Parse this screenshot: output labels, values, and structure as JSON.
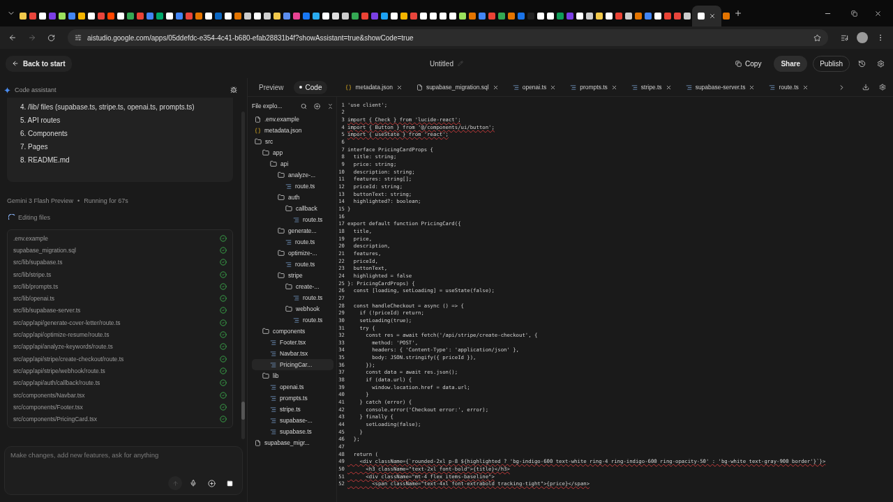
{
  "browser": {
    "tabs": [
      {
        "color": "#f2c94c",
        "selected": false
      },
      {
        "color": "#e8453c",
        "selected": false
      },
      {
        "color": "#ffffff",
        "selected": false
      },
      {
        "color": "#7b3fe4",
        "selected": false
      },
      {
        "color": "#9be15d",
        "selected": false
      },
      {
        "color": "#4285f4",
        "selected": false
      },
      {
        "color": "#f4b400",
        "selected": false
      },
      {
        "color": "#ffffff",
        "selected": false
      },
      {
        "color": "#e8453c",
        "selected": false
      },
      {
        "color": "#ff4500",
        "selected": false
      },
      {
        "color": "#ffffff",
        "selected": false
      },
      {
        "color": "#34a853",
        "selected": false
      },
      {
        "color": "#ea4335",
        "selected": false
      },
      {
        "color": "#4285f4",
        "selected": false
      },
      {
        "color": "#00a86b",
        "selected": false
      },
      {
        "color": "#ffffff",
        "selected": false
      },
      {
        "color": "#4285f4",
        "selected": false
      },
      {
        "color": "#e8453c",
        "selected": false
      },
      {
        "color": "#e37400",
        "selected": false
      },
      {
        "color": "#ffffff",
        "selected": false
      },
      {
        "color": "#0a66c2",
        "selected": false
      },
      {
        "color": "#ffffff",
        "selected": false
      },
      {
        "color": "#e37400",
        "selected": false
      },
      {
        "color": "#cccccc",
        "selected": false
      },
      {
        "color": "#ffffff",
        "selected": false
      },
      {
        "color": "#d0d0d0",
        "selected": false
      },
      {
        "color": "#f2c94c",
        "selected": false
      },
      {
        "color": "#5b8def",
        "selected": false
      },
      {
        "color": "#e84393",
        "selected": false
      },
      {
        "color": "#1877f2",
        "selected": false
      },
      {
        "color": "#2aabee",
        "selected": false
      },
      {
        "color": "#ffffff",
        "selected": false
      },
      {
        "color": "#dddddd",
        "selected": false
      },
      {
        "color": "#cccccc",
        "selected": false
      },
      {
        "color": "#34a853",
        "selected": false
      },
      {
        "color": "#ea4335",
        "selected": false
      },
      {
        "color": "#7b3fe4",
        "selected": false
      },
      {
        "color": "#1da1f2",
        "selected": false
      },
      {
        "color": "#ffffff",
        "selected": false
      },
      {
        "color": "#f4b400",
        "selected": false
      },
      {
        "color": "#e8453c",
        "selected": false
      },
      {
        "color": "#ffffff",
        "selected": false
      },
      {
        "color": "#ffffff",
        "selected": false
      },
      {
        "color": "#ffffff",
        "selected": false
      },
      {
        "color": "#ffffff",
        "selected": false
      },
      {
        "color": "#9be15d",
        "selected": false
      },
      {
        "color": "#e37400",
        "selected": false
      },
      {
        "color": "#4285f4",
        "selected": false
      },
      {
        "color": "#ea4335",
        "selected": false
      },
      {
        "color": "#34a853",
        "selected": false
      },
      {
        "color": "#e37400",
        "selected": false
      },
      {
        "color": "#1a73e8",
        "selected": false
      },
      {
        "color": "#222222",
        "selected": false
      },
      {
        "color": "#ffffff",
        "selected": false
      },
      {
        "color": "#ffffff",
        "selected": false
      },
      {
        "color": "#0f9d58",
        "selected": false
      },
      {
        "color": "#7b3fe4",
        "selected": false
      },
      {
        "color": "#ffffff",
        "selected": false
      },
      {
        "color": "#cccccc",
        "selected": false
      },
      {
        "color": "#f2c94c",
        "selected": false
      },
      {
        "color": "#ffffff",
        "selected": false
      },
      {
        "color": "#ea4335",
        "selected": false
      },
      {
        "color": "#cccccc",
        "selected": false
      },
      {
        "color": "#e37400",
        "selected": false
      },
      {
        "color": "#4285f4",
        "selected": false
      },
      {
        "color": "#ffffff",
        "selected": false
      },
      {
        "color": "#ea4335",
        "selected": false
      },
      {
        "color": "#e8453c",
        "selected": false
      },
      {
        "color": "#cccccc",
        "selected": false
      },
      {
        "color": "#ffffff",
        "selected": true
      },
      {
        "color": "#e37400",
        "selected": false
      }
    ],
    "url": "aistudio.google.com/apps/05ddefdc-e354-4c41-b680-efab28831b4f?showAssistant=true&showCode=true"
  },
  "header": {
    "back": "Back to start",
    "title": "Untitled",
    "actions": [
      "Copy",
      "Share",
      "Publish"
    ]
  },
  "assistant": {
    "title": "Code assistant",
    "steps": [
      "4. /lib/ files (supabase.ts, stripe.ts, openai.ts, prompts.ts)",
      "5. API routes",
      "6. Components",
      "7. Pages",
      "8. README.md"
    ],
    "model": "Gemini 3 Flash Preview",
    "separator": "•",
    "running": "Running for 67s",
    "activity": "Editing files",
    "files": [
      ".env.example",
      "supabase_migration.sql",
      "src/lib/supabase.ts",
      "src/lib/stripe.ts",
      "src/lib/prompts.ts",
      "src/lib/openai.ts",
      "src/lib/supabase-server.ts",
      "src/app/api/generate-cover-letter/route.ts",
      "src/app/api/optimize-resume/route.ts",
      "src/app/api/analyze-keywords/route.ts",
      "src/app/api/stripe/create-checkout/route.ts",
      "src/app/api/stripe/webhook/route.ts",
      "src/app/api/auth/callback/route.ts",
      "src/components/Navbar.tsx",
      "src/components/Footer.tsx",
      "src/components/PricingCard.tsx"
    ],
    "input_placeholder": "Make changes, add new features, ask for anything"
  },
  "editor": {
    "views": [
      {
        "label": "Preview",
        "selected": false
      },
      {
        "label": "Code",
        "selected": true
      }
    ],
    "file_tabs": [
      {
        "name": "metadata.json",
        "kind": "json"
      },
      {
        "name": "supabase_migration.sql",
        "kind": "file"
      },
      {
        "name": "openai.ts",
        "kind": "code"
      },
      {
        "name": "prompts.ts",
        "kind": "code"
      },
      {
        "name": "stripe.ts",
        "kind": "code"
      },
      {
        "name": "supabase-server.ts",
        "kind": "code"
      },
      {
        "name": "route.ts",
        "kind": "code"
      }
    ],
    "explorer_title": "File explo...",
    "tree": [
      {
        "name": ".env.example",
        "kind": "file",
        "selected": false
      },
      {
        "name": "metadata.json",
        "kind": "json",
        "selected": false
      },
      {
        "name": "src",
        "kind": "folder",
        "selected": false,
        "children": [
          {
            "name": "app",
            "kind": "folder",
            "selected": false,
            "children": [
              {
                "name": "api",
                "kind": "folder",
                "selected": false,
                "children": [
                  {
                    "name": "analyze-...",
                    "kind": "folder",
                    "selected": false,
                    "children": [
                      {
                        "name": "route.ts",
                        "kind": "code",
                        "selected": false
                      }
                    ]
                  },
                  {
                    "name": "auth",
                    "kind": "folder",
                    "selected": false,
                    "children": [
                      {
                        "name": "callback",
                        "kind": "folder",
                        "selected": false,
                        "children": [
                          {
                            "name": "route.ts",
                            "kind": "code",
                            "selected": false
                          }
                        ]
                      }
                    ]
                  },
                  {
                    "name": "generate...",
                    "kind": "folder",
                    "selected": false,
                    "children": [
                      {
                        "name": "route.ts",
                        "kind": "code",
                        "selected": false
                      }
                    ]
                  },
                  {
                    "name": "optimize-...",
                    "kind": "folder",
                    "selected": false,
                    "children": [
                      {
                        "name": "route.ts",
                        "kind": "code",
                        "selected": false
                      }
                    ]
                  },
                  {
                    "name": "stripe",
                    "kind": "folder",
                    "selected": false,
                    "children": [
                      {
                        "name": "create-...",
                        "kind": "folder",
                        "selected": false,
                        "children": [
                          {
                            "name": "route.ts",
                            "kind": "code",
                            "selected": false
                          }
                        ]
                      },
                      {
                        "name": "webhook",
                        "kind": "folder",
                        "selected": false,
                        "children": [
                          {
                            "name": "route.ts",
                            "kind": "code",
                            "selected": false
                          }
                        ]
                      }
                    ]
                  }
                ]
              }
            ]
          },
          {
            "name": "components",
            "kind": "folder",
            "selected": false,
            "children": [
              {
                "name": "Footer.tsx",
                "kind": "code",
                "selected": false
              },
              {
                "name": "Navbar.tsx",
                "kind": "code",
                "selected": false
              },
              {
                "name": "PricingCar...",
                "kind": "code",
                "selected": true
              }
            ]
          },
          {
            "name": "lib",
            "kind": "folder",
            "selected": false,
            "children": [
              {
                "name": "openai.ts",
                "kind": "code",
                "selected": false
              },
              {
                "name": "prompts.ts",
                "kind": "code",
                "selected": false
              },
              {
                "name": "stripe.ts",
                "kind": "code",
                "selected": false
              },
              {
                "name": "supabase-...",
                "kind": "code",
                "selected": false
              },
              {
                "name": "supabase.ts",
                "kind": "code",
                "selected": false
              }
            ]
          }
        ]
      },
      {
        "name": "supabase_migr...",
        "kind": "file",
        "selected": false
      }
    ],
    "code": [
      {
        "n": "1",
        "text": "'use client';"
      },
      {
        "n": "2"
      },
      {
        "n": "3",
        "text": "import { Check } from 'lucide-react';",
        "error": true
      },
      {
        "n": "4",
        "text": "import { Button } from '@/components/ui/button';",
        "error": true
      },
      {
        "n": "5",
        "text": "import { useState } from 'react';",
        "error": true
      },
      {
        "n": "6"
      },
      {
        "n": "7",
        "text": "interface PricingCardProps {"
      },
      {
        "n": "8",
        "text": "  title: string;"
      },
      {
        "n": "9",
        "text": "  price: string;"
      },
      {
        "n": "10",
        "text": "  description: string;"
      },
      {
        "n": "11",
        "text": "  features: string[];"
      },
      {
        "n": "12",
        "text": "  priceId: string;"
      },
      {
        "n": "13",
        "text": "  buttonText: string;"
      },
      {
        "n": "14",
        "text": "  highlighted?: boolean;"
      },
      {
        "n": "15",
        "text": "}"
      },
      {
        "n": "16"
      },
      {
        "n": "17",
        "text": "export default function PricingCard({"
      },
      {
        "n": "18",
        "text": "  title,"
      },
      {
        "n": "19",
        "text": "  price,"
      },
      {
        "n": "20",
        "text": "  description,"
      },
      {
        "n": "21",
        "text": "  features,"
      },
      {
        "n": "22",
        "text": "  priceId,"
      },
      {
        "n": "23",
        "text": "  buttonText,"
      },
      {
        "n": "24",
        "text": "  highlighted = false"
      },
      {
        "n": "25",
        "text": "}: PricingCardProps) {"
      },
      {
        "n": "26",
        "text": "  const [loading, setLoading] = useState(false);"
      },
      {
        "n": "27"
      },
      {
        "n": "28",
        "text": "  const handleCheckout = async () => {"
      },
      {
        "n": "29",
        "text": "    if (!priceId) return;"
      },
      {
        "n": "30",
        "text": "    setLoading(true);"
      },
      {
        "n": "31",
        "text": "    try {"
      },
      {
        "n": "32",
        "text": "      const res = await fetch('/api/stripe/create-checkout', {"
      },
      {
        "n": "33",
        "text": "        method: 'POST',"
      },
      {
        "n": "34",
        "text": "        headers: { 'Content-Type': 'application/json' },"
      },
      {
        "n": "35",
        "text": "        body: JSON.stringify({ priceId }),"
      },
      {
        "n": "36",
        "text": "      });"
      },
      {
        "n": "37",
        "text": "      const data = await res.json();"
      },
      {
        "n": "38",
        "text": "      if (data.url) {"
      },
      {
        "n": "39",
        "text": "        window.location.href = data.url;"
      },
      {
        "n": "40",
        "text": "      }"
      },
      {
        "n": "41",
        "text": "    } catch (error) {"
      },
      {
        "n": "42",
        "text": "      console.error('Checkout error:', error);"
      },
      {
        "n": "43",
        "text": "    } finally {"
      },
      {
        "n": "44",
        "text": "      setLoading(false);"
      },
      {
        "n": "45",
        "text": "    }"
      },
      {
        "n": "46",
        "text": "  };"
      },
      {
        "n": "47"
      },
      {
        "n": "48",
        "text": "  return ("
      },
      {
        "n": "49",
        "text": "    <div className={`rounded-2xl p-8 ${highlighted ? 'bg-indigo-600 text-white ring-4 ring-indigo-600 ring-opacity-50' : 'bg-white text-gray-900 border'}`}>",
        "error": true
      },
      {
        "n": "50",
        "text": "      <h3 className=\"text-2xl font-bold\">{title}</h3>",
        "error": true
      },
      {
        "n": "51",
        "text": "      <div className=\"mt-4 flex items-baseline\">",
        "error": true
      },
      {
        "n": "52",
        "text": "        <span className=\"text-4xl font-extrabold tracking-tight\">{price}</span>",
        "error": true
      }
    ]
  }
}
